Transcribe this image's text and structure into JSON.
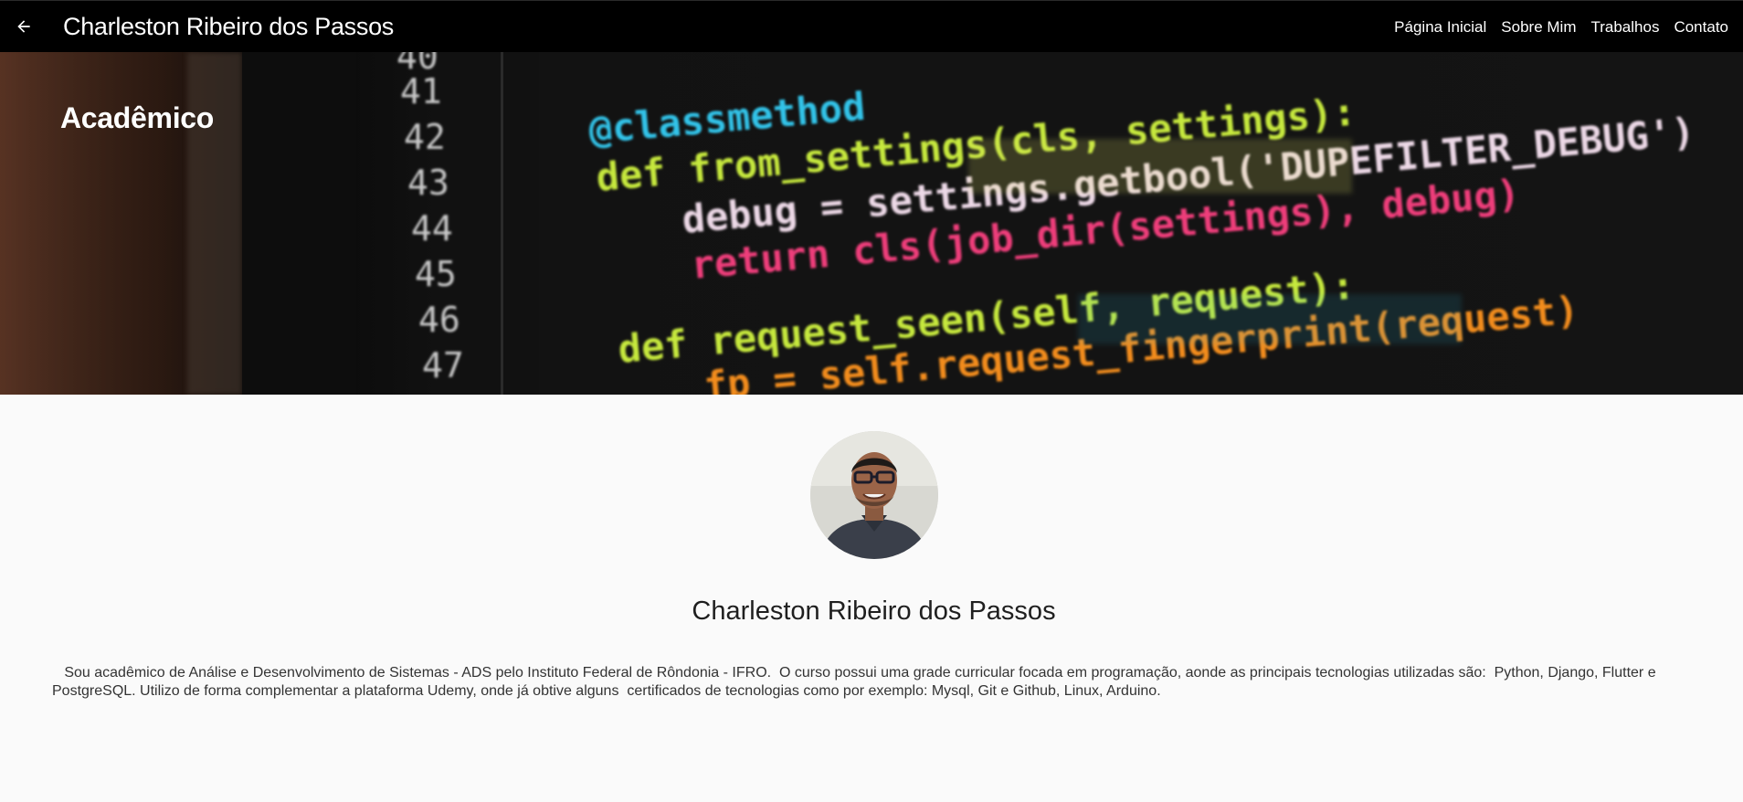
{
  "appbar": {
    "back_icon": "arrow-back-icon",
    "title": "Charleston Ribeiro dos Passos",
    "nav": [
      "Página Inicial",
      "Sobre Mim",
      "Trabalhos",
      "Contato"
    ]
  },
  "hero": {
    "title": "Acadêmico",
    "line_numbers": [
      "40",
      "41",
      "42",
      "43",
      "44",
      "45",
      "46",
      "47"
    ],
    "code_lines": [
      "@classmethod",
      "def from_settings(cls, settings):",
      "debug = settings.getbool('DUPEFILTER_DEBUG')",
      "return cls(job_dir(settings), debug)",
      "def request_seen(self, request):",
      "fp = self.request_fingerprint(request)"
    ]
  },
  "profile": {
    "avatar_icon": "profile-photo",
    "name": "Charleston Ribeiro dos Passos",
    "bio": "   Sou acadêmico de Análise e Desenvolvimento de Sistemas - ADS pelo Instituto Federal de Rôndonia - IFRO.  O curso possui uma grade curricular focada em programação, aonde as principais tecnologias utilizadas são:  Python, Django, Flutter e PostgreSQL. Utilizo de forma complementar a plataforma Udemy, onde já obtive alguns  certificados de tecnologias como por exemplo: Mysql, Git e Github, Linux, Arduino."
  },
  "colors": {
    "appbar": "#000000",
    "background": "#fafafa",
    "code_cyan": "#33c3e8",
    "code_green": "#c6e83c",
    "code_orange": "#f28c1c",
    "code_pink": "#ee3d7a"
  }
}
